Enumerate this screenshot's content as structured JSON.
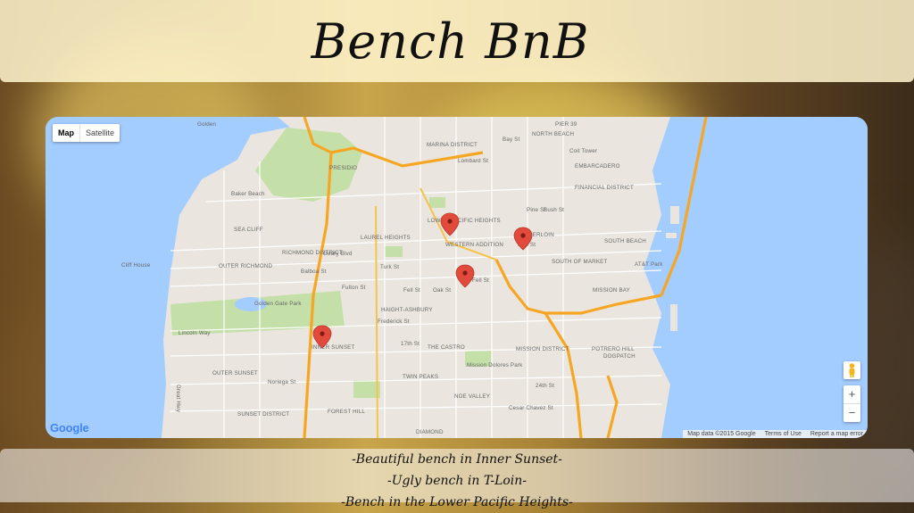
{
  "header": {
    "title": "Bench BnB"
  },
  "map": {
    "type_controls": {
      "map": "Map",
      "satellite": "Satellite"
    },
    "zoom": {
      "in": "+",
      "out": "−"
    },
    "logo": "Google",
    "footer": {
      "data": "Map data ©2015 Google",
      "terms": "Terms of Use",
      "report": "Report a map error"
    },
    "labels": [
      "PIER 39",
      "MARINA DISTRICT",
      "Bay St",
      "NORTH BEACH",
      "Coit Tower",
      "Lombard St",
      "EMBARCADERO",
      "PRESIDIO",
      "FINANCIAL DISTRICT",
      "Baker Beach",
      "Pine St",
      "Bush St",
      "LOWER PACIFIC HEIGHTS",
      "SEA CLIFF",
      "LAUREL HEIGHTS",
      "TENDERLOIN",
      "Turk St",
      "SOUTH BEACH",
      "RICHMOND DISTRICT",
      "Geary Blvd",
      "WESTERN ADDITION",
      "Cliff House",
      "OUTER RICHMOND",
      "Balboa St",
      "Turk St",
      "SOUTH OF MARKET",
      "AT&T Park",
      "Fulton St",
      "Fell St",
      "Oak St",
      "Fell St",
      "MISSION BAY",
      "Golden Gate Park",
      "HAIGHT-ASHBURY",
      "Lincoln Way",
      "Frederick St",
      "INNER SUNSET",
      "17th St",
      "THE CASTRO",
      "POTRERO HILL",
      "MISSION DISTRICT",
      "Mission Dolores Park",
      "DOGPATCH",
      "OUTER SUNSET",
      "Noriega St",
      "TWIN PEAKS",
      "NOE VALLEY",
      "24th St",
      "SUNSET DISTRICT",
      "Cesar Chavez St",
      "FOREST HILL",
      "DIAMOND",
      "Great Hwy",
      "Golden"
    ]
  },
  "benches": [
    "-Beautiful bench in Inner Sunset-",
    "-Ugly bench in T-Loin-",
    "-Bench in the Lower Pacific Heights-"
  ],
  "colors": {
    "water": "#a3ccff",
    "land": "#eae6df",
    "park": "#c4dfa8",
    "highway": "#f6a623",
    "pin": "#e24a3b"
  }
}
